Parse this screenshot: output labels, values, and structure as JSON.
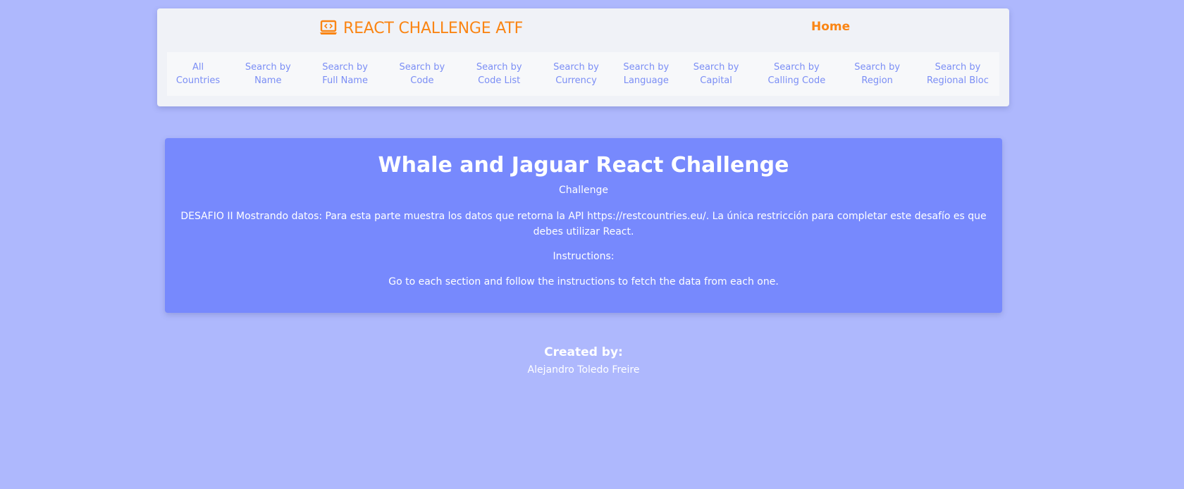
{
  "header": {
    "brand": "REACT CHALLENGE ATF",
    "brand_icon": "laptop-code-icon",
    "home_label": "Home",
    "accent_color": "#fa8514"
  },
  "nav": {
    "items": [
      {
        "label": "All Countries"
      },
      {
        "label": "Search by Name"
      },
      {
        "label": "Search by Full Name"
      },
      {
        "label": "Search by Code"
      },
      {
        "label": "Search by Code List"
      },
      {
        "label": "Search by Currency"
      },
      {
        "label": "Search by Language"
      },
      {
        "label": "Search by Capital"
      },
      {
        "label": "Search by Calling Code"
      },
      {
        "label": "Search by Region"
      },
      {
        "label": "Search by Regional Bloc"
      }
    ],
    "link_color": "#7b8ef5"
  },
  "main": {
    "title": "Whale and Jaguar React Challenge",
    "subtitle": "Challenge",
    "description": "DESAFIO II Mostrando datos: Para esta parte muestra los datos que retorna la API https://restcountries.eu/. La única restricción para completar este desafío es que debes utilizar React.",
    "instructions_label": "Instructions:",
    "instructions_text": "Go to each section and follow the instructions to fetch the data from each one.",
    "card_color": "#7789fd"
  },
  "footer": {
    "created_label": "Created by:",
    "author": "Alejandro Toledo Freire"
  },
  "page": {
    "background": "#aeb8fd"
  }
}
